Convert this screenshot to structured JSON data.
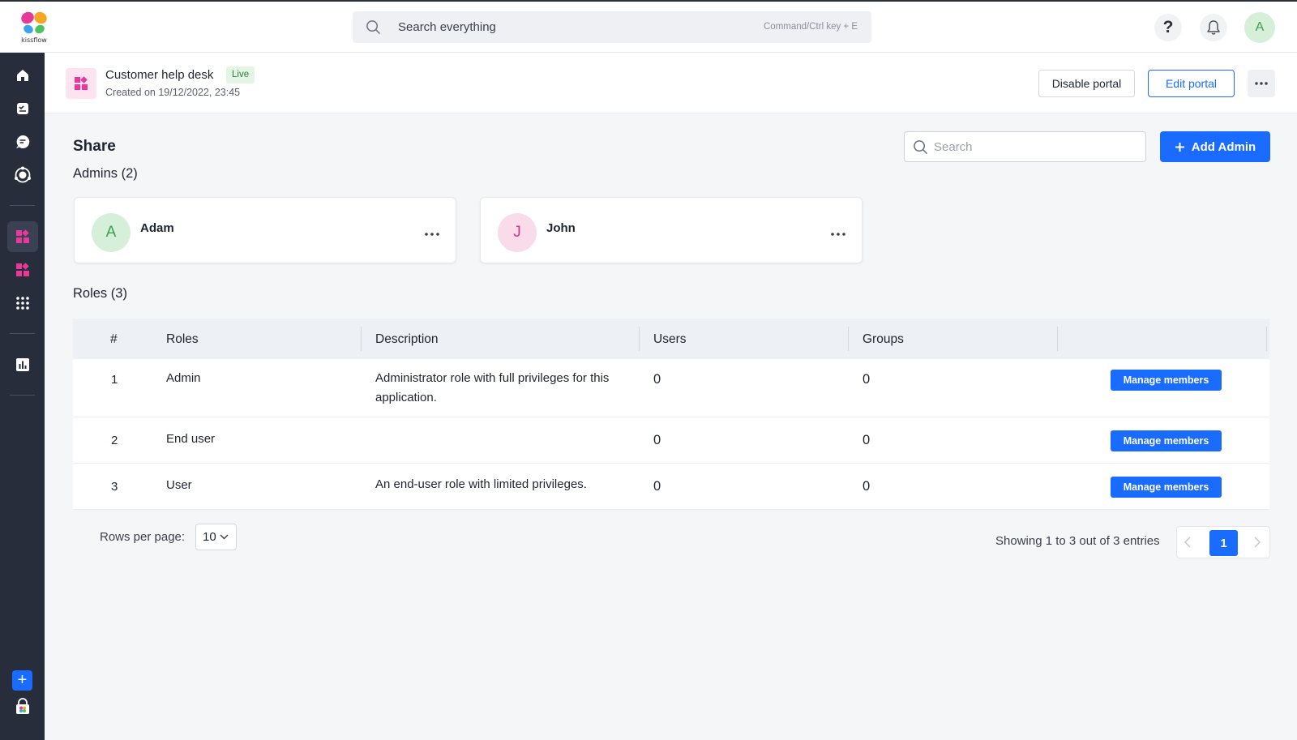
{
  "topbar": {
    "logo_text": "kissflow",
    "search_placeholder": "Search everything",
    "search_hint": "Command/Ctrl key + E",
    "help_label": "?",
    "avatar_initial": "A"
  },
  "app": {
    "title": "Customer help desk",
    "status_badge": "Live",
    "created": "Created on 19/12/2022, 23:45",
    "disable_label": "Disable portal",
    "edit_label": "Edit portal"
  },
  "share": {
    "title": "Share",
    "search_placeholder": "Search",
    "add_admin_label": "Add Admin",
    "admins_heading": "Admins (2)",
    "admins": [
      {
        "initial": "A",
        "name": "Adam"
      },
      {
        "initial": "J",
        "name": "John"
      }
    ],
    "roles_heading": "Roles (3)"
  },
  "roles_table": {
    "columns": [
      "#",
      "Roles",
      "Description",
      "Users",
      "Groups"
    ],
    "rows": [
      {
        "num": "1",
        "role": "Admin",
        "description": "Administrator role with full privileges for this application.",
        "users": "0",
        "groups": "0",
        "action": "Manage members"
      },
      {
        "num": "2",
        "role": "End user",
        "description": "",
        "users": "0",
        "groups": "0",
        "action": "Manage members"
      },
      {
        "num": "3",
        "role": "User",
        "description": "An end-user role with limited privileges.",
        "users": "0",
        "groups": "0",
        "action": "Manage members"
      }
    ]
  },
  "pagination": {
    "rows_per_page_label": "Rows per page:",
    "rows_per_page_value": "10",
    "showing": "Showing 1 to 3 out of 3 entries",
    "current_page": "1"
  },
  "colors": {
    "accent": "#1a6bff",
    "sidebar": "#272d3b",
    "brand_pink": "#e8399a",
    "live_green": "#2f7d3b"
  },
  "icons": {
    "nav": [
      "home-icon",
      "tasks-icon",
      "chat-icon",
      "integrations-icon",
      "portal-icon",
      "apps-icon",
      "grid-icon",
      "reports-icon",
      "add-icon",
      "marketplace-icon"
    ],
    "header": [
      "search-icon",
      "help-icon",
      "bell-icon",
      "more-icon"
    ]
  }
}
